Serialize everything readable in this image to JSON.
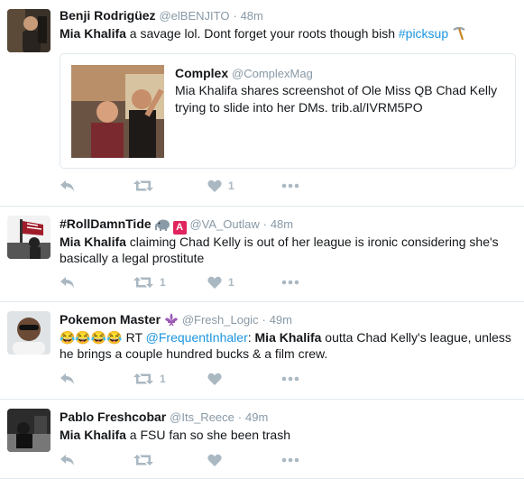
{
  "tweets": [
    {
      "fullname": "Benji Rodrigüez",
      "username": "@elBENJITO",
      "time": "48m",
      "text_mention": "Mia Khalifa",
      "text_rest": " a savage lol. Dont forget your roots though bish ",
      "hashtag": "#picksup",
      "emoji": "pick-icon",
      "quote": {
        "fullname": "Complex",
        "username": "@ComplexMag",
        "text": "Mia Khalifa shares screenshot of Ole Miss QB Chad Kelly trying to slide into her DMs. trib.al/IVRM5PO"
      },
      "likes": "1"
    },
    {
      "fullname": "#RollDamnTide",
      "username": "@VA_Outlaw",
      "time": "48m",
      "badges": [
        "elephant-icon",
        "A"
      ],
      "text_mention": "Mia Khalifa",
      "text_rest": " claiming Chad Kelly is out of her league is ironic considering she's basically a legal prostitute",
      "retweets": "1",
      "likes": "1"
    },
    {
      "fullname": "Pokemon Master",
      "username": "@Fresh_Logic",
      "time": "49m",
      "badges": [
        "fleur-de-lis-icon"
      ],
      "emoji_prefix": "😂😂😂😂",
      "rt": "RT",
      "rt_mention": "@FrequentInhaler",
      "rt_colon": ":",
      "text_mention": "Mia Khalifa",
      "text_rest": " outta Chad Kelly's league, unless he brings a couple hundred bucks & a film crew.",
      "retweets": "1"
    },
    {
      "fullname": "Pablo Freshcobar",
      "username": "@Its_Reece",
      "time": "49m",
      "text_mention": "Mia Khalifa",
      "text_rest": " a FSU fan so she been trash"
    }
  ],
  "colors": {
    "link": "#1b95e0",
    "muted": "#8899a6",
    "action": "#aab8c2",
    "border": "#e1e8ed"
  }
}
